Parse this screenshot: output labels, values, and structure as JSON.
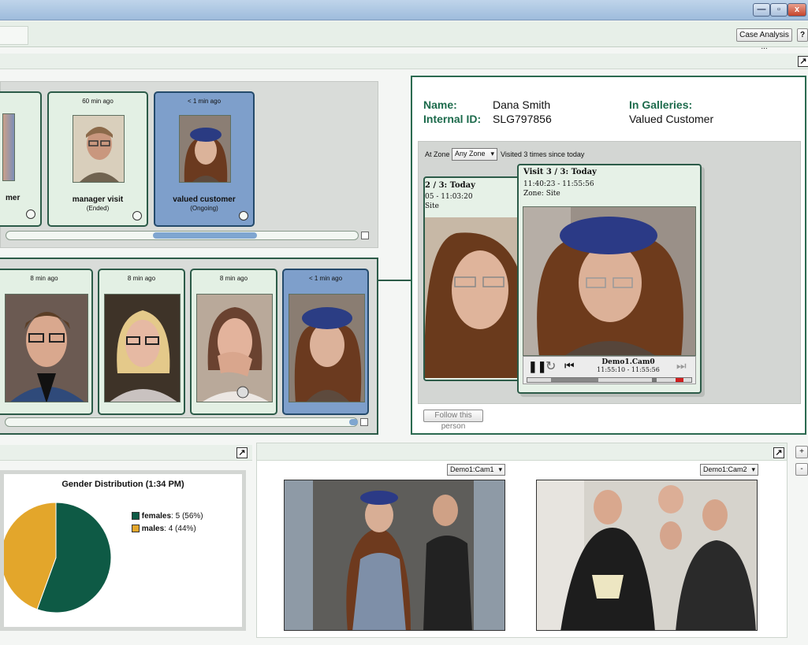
{
  "window": {
    "minimize": "—",
    "maximize": "▫",
    "close": "x"
  },
  "toolbar": {
    "case_analysis": "Case Analysis ...",
    "help": "?"
  },
  "strip1": {
    "cards": [
      {
        "ago": "",
        "caption": "mer",
        "sub": ""
      },
      {
        "ago": "60 min ago",
        "caption": "manager visit",
        "sub": "(Ended)"
      },
      {
        "ago": "< 1 min ago",
        "caption": "valued customer",
        "sub": "(Ongoing)"
      }
    ]
  },
  "strip2": {
    "cards": [
      {
        "ago": "8 min ago"
      },
      {
        "ago": "8 min ago"
      },
      {
        "ago": "8 min ago"
      },
      {
        "ago": "< 1 min ago"
      }
    ]
  },
  "detail": {
    "name_label": "Name:",
    "name_value": "Dana Smith",
    "internal_label": "Internal ID:",
    "internal_value": "SLG797856",
    "galleries_label": "In Galleries:",
    "galleries_value": "Valued Customer",
    "at_zone": "At Zone",
    "zone_select": "Any Zone",
    "visited": "Visited 3 times since today",
    "prev_visit_title": "2 / 3: Today",
    "prev_visit_time": "05 - 11:03:20",
    "prev_visit_zone": "Site",
    "visit_title": "Visit 3 / 3: Today",
    "visit_time": "11:40:23 - 11:55:56",
    "visit_zone": "Zone: Site",
    "player_cam": "Demo1.Cam0",
    "player_time": "11:55:10 - 11:55:56",
    "follow": "Follow this person"
  },
  "gender": {
    "plus": "+",
    "minus": "-"
  },
  "chart_data": {
    "type": "pie",
    "title": "Gender Distribution (1:34 PM)",
    "series": [
      {
        "name": "females",
        "value": 5,
        "percent": "(56%)",
        "color": "#0e5a45"
      },
      {
        "name": "males",
        "value": 4,
        "percent": "(44%)",
        "color": "#e3a62b"
      }
    ]
  },
  "cameras": {
    "cam1": "Demo1:Cam1",
    "cam2": "Demo1:Cam2"
  }
}
